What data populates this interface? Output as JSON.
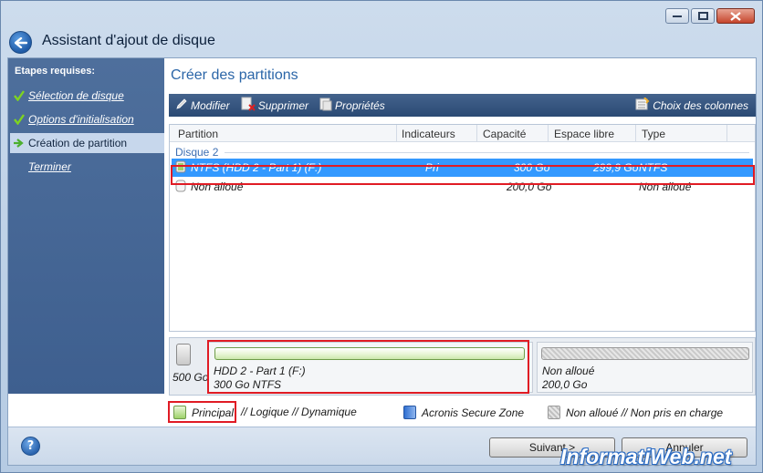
{
  "window": {
    "title": "Assistant d'ajout de disque",
    "controls": [
      "minimize-icon",
      "maximize-icon",
      "close-icon"
    ]
  },
  "sidebar": {
    "title": "Etapes requises:",
    "items": [
      {
        "label": "Sélection de disque",
        "status": "done"
      },
      {
        "label": "Options d'initialisation",
        "status": "done"
      },
      {
        "label": "Création de partition",
        "status": "current"
      },
      {
        "label": "Terminer",
        "status": "pending"
      }
    ]
  },
  "main": {
    "title": "Créer des partitions",
    "toolbar": {
      "modify": "Modifier",
      "delete": "Supprimer",
      "properties": "Propriétés",
      "columns": "Choix des colonnes"
    },
    "table": {
      "columns": [
        "Partition",
        "Indicateurs",
        "Capacité",
        "Espace libre",
        "Type"
      ],
      "group": "Disque 2",
      "rows": [
        {
          "partition": "NTFS (HDD 2 - Part 1) (F:)",
          "flags": "Pri",
          "capacity": "300 Go",
          "free": "299,9 Go",
          "type": "NTFS",
          "selected": true
        },
        {
          "partition": "Non alloué",
          "flags": "",
          "capacity": "200,0 Go",
          "free": "",
          "type": "Non alloué",
          "selected": false
        }
      ]
    },
    "diskmap": {
      "disk_size": "500 Go",
      "partitions": [
        {
          "name": "HDD 2 - Part 1 (F:)",
          "detail": "300 Go  NTFS"
        },
        {
          "name": "Non alloué",
          "detail": "200,0 Go"
        }
      ]
    },
    "legend": {
      "principal": "Principal",
      "logical_dynamic": "// Logique // Dynamique",
      "secure_zone": "Acronis Secure Zone",
      "unallocated": "Non alloué // Non pris en charge"
    }
  },
  "footer": {
    "next": "Suivant >",
    "cancel": "Annuler"
  },
  "watermark": "InformatiWeb.net",
  "colors": {
    "selection": "#3399ff",
    "highlight_box": "#e01b24",
    "toolbar": "#2a4a74",
    "sidebar": "#4e6f9c"
  }
}
